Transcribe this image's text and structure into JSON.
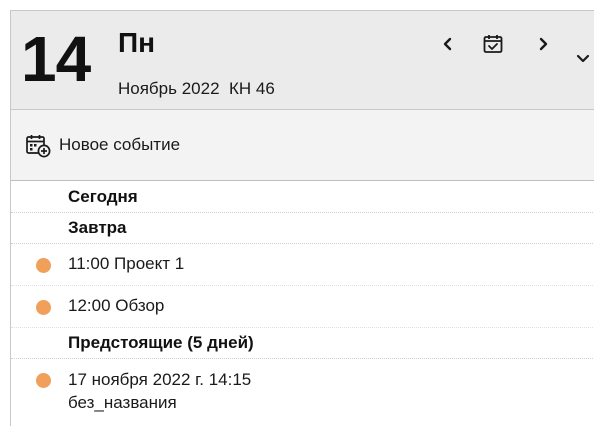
{
  "header": {
    "day_number": "14",
    "weekday": "Пн",
    "month_year": "Ноябрь 2022",
    "week": "КН 46"
  },
  "toolbar": {
    "new_event_label": "Новое событие",
    "new_event_icon": "calendar-add-icon"
  },
  "nav": {
    "prev_icon": "chevron-left-icon",
    "today_icon": "calendar-check-icon",
    "next_icon": "chevron-right-icon",
    "more_icon": "chevron-down-icon"
  },
  "groups": {
    "today": "Сегодня",
    "tomorrow": "Завтра",
    "upcoming": "Предстоящие (5 дней)"
  },
  "events": {
    "tomorrow": [
      {
        "time": "11:00",
        "title": "Проект 1",
        "color": "#f0a05a"
      },
      {
        "time": "12:00",
        "title": "Обзор",
        "color": "#f0a05a"
      }
    ],
    "upcoming": [
      {
        "datetime": "17 ноября 2022 г. 14:15",
        "title": "без_названия",
        "color": "#f0a05a"
      }
    ]
  }
}
